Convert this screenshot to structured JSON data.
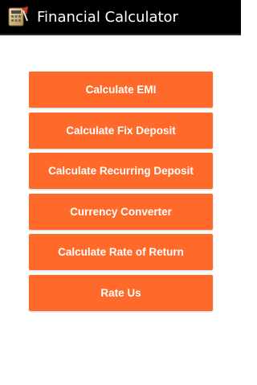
{
  "app_bar": {
    "title": "Financial Calculator",
    "icon": "calculator-app-icon"
  },
  "menu": {
    "buttons": [
      "Calculate EMI",
      "Calculate Fix Deposit",
      "Calculate Recurring Deposit",
      "Currency Converter",
      "Calculate Rate of Return",
      "Rate Us"
    ]
  },
  "colors": {
    "action_bar_bg": "#000000",
    "button_bg": "#ff6a2b",
    "button_text": "#ffffff",
    "page_bg": "#ffffff"
  }
}
